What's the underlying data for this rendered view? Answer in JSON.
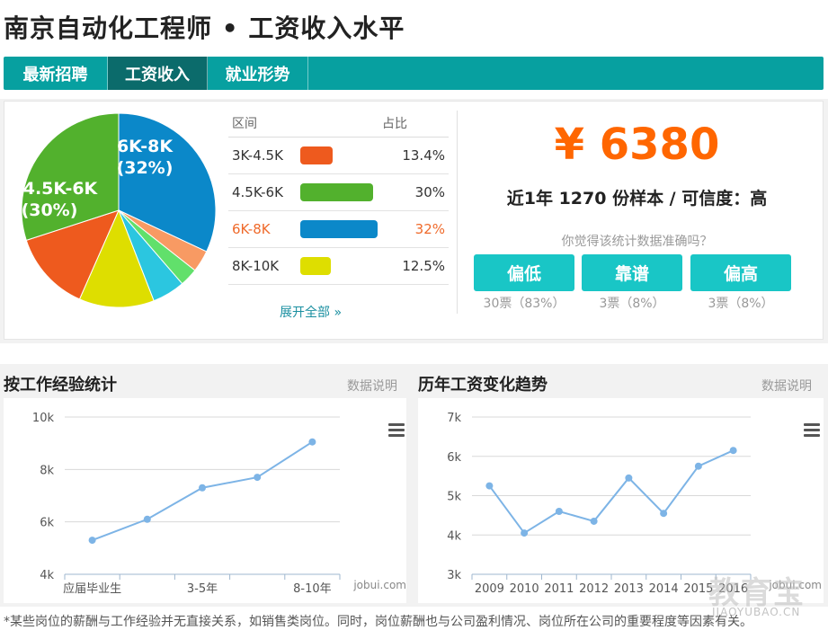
{
  "title": "南京自动化工程师 • 工资收入水平",
  "tabs": [
    {
      "label": "最新招聘"
    },
    {
      "label": "工资收入"
    },
    {
      "label": "就业形势"
    }
  ],
  "distribution": {
    "header_range": "区间",
    "header_pct": "占比",
    "rows": [
      {
        "label": "3K-4.5K",
        "pct": "13.4%",
        "fraction": 0.134,
        "color": "#ee5a1e"
      },
      {
        "label": "4.5K-6K",
        "pct": "30%",
        "fraction": 0.3,
        "color": "#52b12d"
      },
      {
        "label": "6K-8K",
        "pct": "32%",
        "fraction": 0.32,
        "color": "#0b88c9"
      },
      {
        "label": "8K-10K",
        "pct": "12.5%",
        "fraction": 0.125,
        "color": "#dede00"
      }
    ],
    "expand_label": "展开全部 »",
    "pie_labels": {
      "big1_range": "6K-8K",
      "big1_pct": "(32%)",
      "big2_range": "4.5K-6K",
      "big2_pct": "(30%)"
    },
    "pie_other_colors": [
      "#2bc6e0",
      "#61e06b",
      "#f89a63"
    ]
  },
  "summary": {
    "salary": "¥ 6380",
    "sample": "近1年 1270 份样本 / 可信度：高",
    "question": "你觉得该统计数据准确吗？",
    "votes": [
      {
        "label": "偏低",
        "count": "30票（83%）"
      },
      {
        "label": "靠谱",
        "count": "3票（8%）"
      },
      {
        "label": "偏高",
        "count": "3票（8%）"
      }
    ]
  },
  "experience_section": {
    "title": "按工作经验统计",
    "note": "数据说明",
    "credit": "jobui.com"
  },
  "trend_section": {
    "title": "历年工资变化趋势",
    "note": "数据说明",
    "credit": "jobui.com"
  },
  "chart_data": [
    {
      "type": "line",
      "categories": [
        "应届毕业生",
        "",
        "3-5年",
        "",
        "8-10年"
      ],
      "values": [
        5300,
        6100,
        7300,
        7700,
        9050
      ],
      "y_ticks": [
        "4k",
        "6k",
        "8k",
        "10k"
      ],
      "ylim": [
        4000,
        10000
      ],
      "color": "#7db4e6",
      "grid": true
    },
    {
      "type": "line",
      "categories": [
        "2009",
        "2010",
        "2011",
        "2012",
        "2013",
        "2014",
        "2015",
        "2016"
      ],
      "values": [
        5250,
        4050,
        4600,
        4350,
        5450,
        4550,
        5750,
        6150
      ],
      "y_ticks": [
        "3k",
        "4k",
        "5k",
        "6k",
        "7k"
      ],
      "ylim": [
        3000,
        7000
      ],
      "color": "#7db4e6",
      "grid": true
    }
  ],
  "footnote": "*某些岗位的薪酬与工作经验并无直接关系，如销售类岗位。同时，岗位薪酬也与公司盈利情况、岗位所在公司的重要程度等因素有关。",
  "watermark": {
    "main": "教育宝",
    "sub": "JIAOYUBAO.CN"
  },
  "colors": {
    "tab_bg": "#07a0a0",
    "tab_active": "#0b6b6b",
    "accent_orange": "#ff6600",
    "vote_button": "#19c6c6"
  }
}
